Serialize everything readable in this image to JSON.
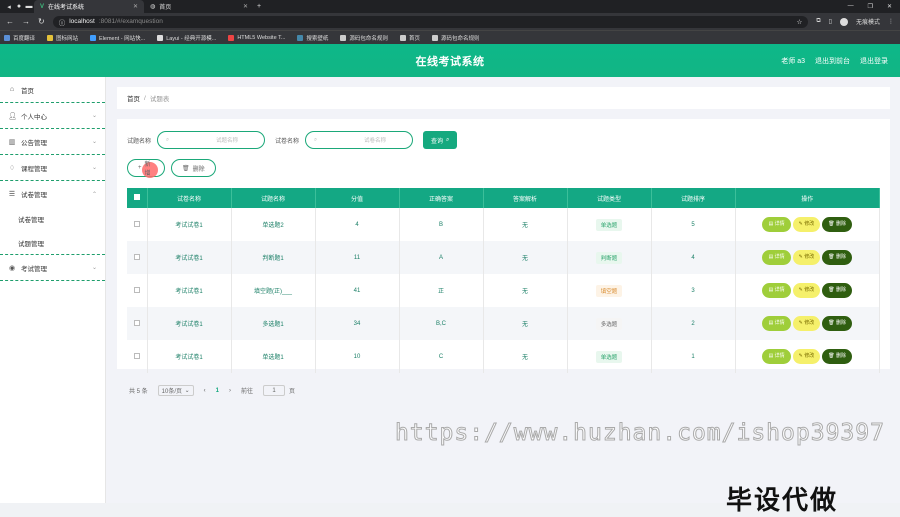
{
  "browser": {
    "tabs": [
      {
        "title": "在线考试系统",
        "active": true
      },
      {
        "title": "首页",
        "active": false
      }
    ],
    "url_host": "localhost",
    "url_rest": ":8081/#/examquestion",
    "profile_label": "无痕模式",
    "bookmarks": [
      "百度翻译",
      "图标网站",
      "Element - 网站快...",
      "Layui - 经典开源模...",
      "HTML5 Website T...",
      "搜索壁纸",
      "源码包命名规则",
      "首页",
      "源码包命名规则"
    ]
  },
  "header": {
    "title": "在线考试系统",
    "user": "老师 a3",
    "back_label": "退出到前台",
    "logout_label": "退出登录"
  },
  "sidebar": {
    "home": "首页",
    "items": [
      {
        "label": "个人中心"
      },
      {
        "label": "公告管理"
      },
      {
        "label": "课程管理"
      },
      {
        "label": "试卷管理"
      }
    ],
    "sub_items": [
      "试卷管理",
      "试题管理"
    ],
    "exam_manage": "考试管理"
  },
  "breadcrumb": {
    "home": "首页",
    "separator": "/",
    "current": "试题表"
  },
  "search": {
    "label1": "试题名称",
    "placeholder1": "试题名称",
    "label2": "试卷名称",
    "placeholder2": "试卷名称",
    "query_label": "查询"
  },
  "actions": {
    "add_label": "新增",
    "delete_label": "删除"
  },
  "table": {
    "headers": [
      "试卷名称",
      "试题名称",
      "分值",
      "正确答案",
      "答案解析",
      "试题类型",
      "试题排序",
      "操作"
    ],
    "rows": [
      {
        "paper": "考试试卷1",
        "question": "单选题2",
        "score": "4",
        "answer": "B",
        "analysis": "无",
        "type": "单选题",
        "order": "5"
      },
      {
        "paper": "考试试卷1",
        "question": "判断题1",
        "score": "11",
        "answer": "A",
        "analysis": "无",
        "type": "判断题",
        "order": "4"
      },
      {
        "paper": "考试试卷1",
        "question": "填空题(正)___",
        "score": "41",
        "answer": "正",
        "analysis": "无",
        "type": "填空题",
        "order": "3"
      },
      {
        "paper": "考试试卷1",
        "question": "多选题1",
        "score": "34",
        "answer": "B,C",
        "analysis": "无",
        "type": "多选题",
        "order": "2"
      },
      {
        "paper": "考试试卷1",
        "question": "单选题1",
        "score": "10",
        "answer": "C",
        "analysis": "无",
        "type": "单选题",
        "order": "1"
      }
    ],
    "op_labels": {
      "review": "详情",
      "edit": "修改",
      "delete": "删除"
    }
  },
  "pager": {
    "total": "共 5 条",
    "page_size": "10条/页",
    "prev": "‹",
    "current": "1",
    "next": "›",
    "goto_label": "前往",
    "goto_value": "1",
    "page_suffix": "页"
  },
  "watermark": "https://www.huzhan.com/ishop39397",
  "stamp": "毕设代做",
  "colors": {
    "primary": "#14a884",
    "review": "#9fce3a",
    "edit": "#f5f06b",
    "delete": "#2f5e10"
  }
}
